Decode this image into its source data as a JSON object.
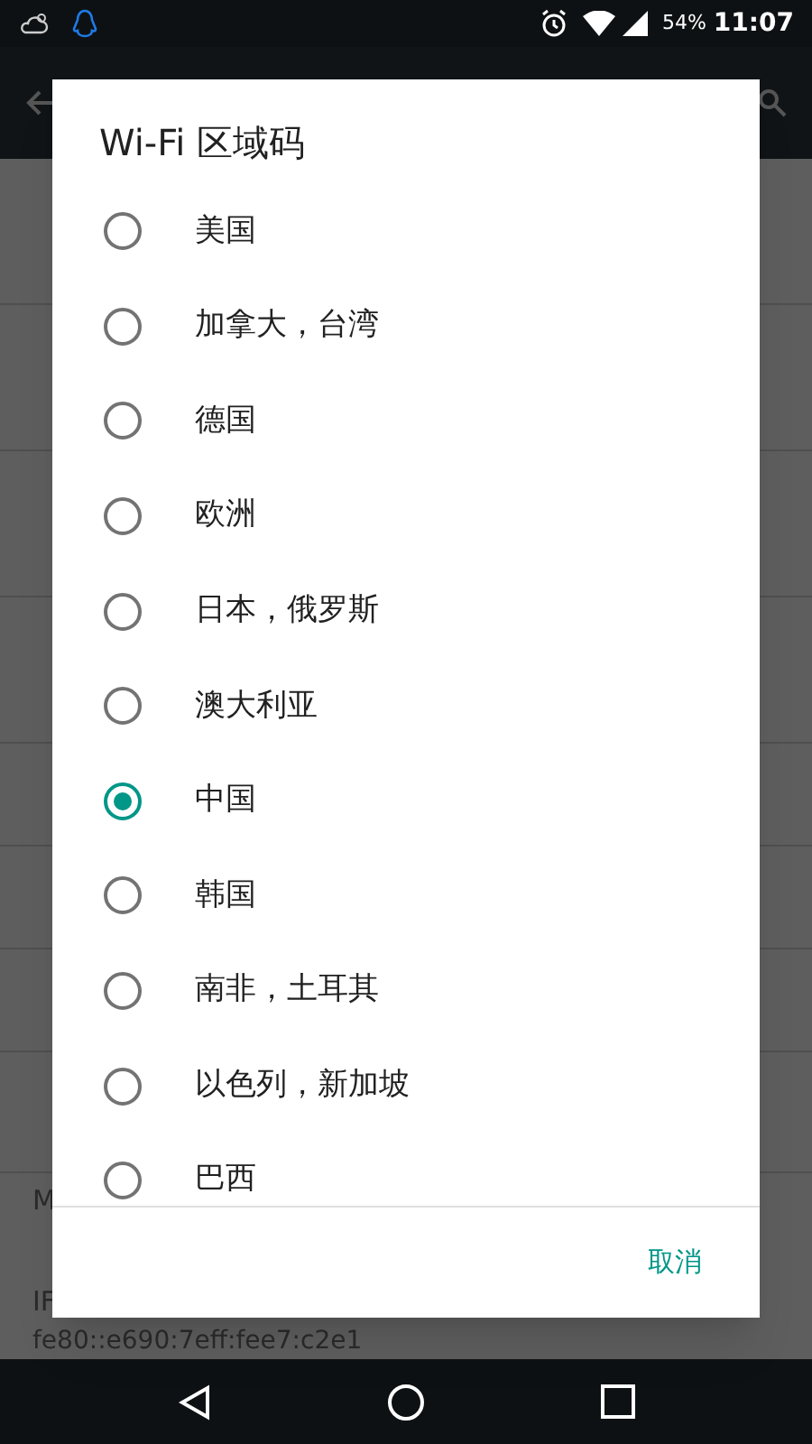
{
  "status_bar": {
    "battery": "54%",
    "time": "11:07"
  },
  "background_list": [
    {
      "title": "M"
    },
    {
      "title": "IF",
      "subtitle": "fe80::e690:7eff:fee7:c2e1"
    }
  ],
  "dialog": {
    "title": "Wi-Fi 区域码",
    "options": [
      {
        "label": "美国",
        "selected": false
      },
      {
        "label": "加拿大，台湾",
        "selected": false
      },
      {
        "label": "德国",
        "selected": false
      },
      {
        "label": "欧洲",
        "selected": false
      },
      {
        "label": "日本，俄罗斯",
        "selected": false
      },
      {
        "label": "澳大利亚",
        "selected": false
      },
      {
        "label": "中国",
        "selected": true
      },
      {
        "label": "韩国",
        "selected": false
      },
      {
        "label": "南非，土耳其",
        "selected": false
      },
      {
        "label": "以色列，新加坡",
        "selected": false
      },
      {
        "label": "巴西",
        "selected": false
      }
    ],
    "buttons": [
      "取消"
    ]
  }
}
